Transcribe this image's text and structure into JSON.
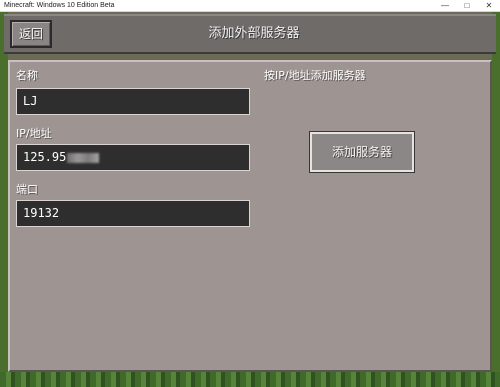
{
  "window": {
    "title": "Minecraft: Windows 10 Edition Beta",
    "min_icon": "—",
    "max_icon": "□",
    "close_icon": "✕"
  },
  "header": {
    "back_label": "返回",
    "title": "添加外部服务器"
  },
  "form": {
    "name_label": "名称",
    "name_value": "LJ",
    "ip_label": "IP/地址",
    "ip_value": "125.95",
    "port_label": "端口",
    "port_value": "19132"
  },
  "right": {
    "title": "按IP/地址添加服务器",
    "add_button": "添加服务器"
  }
}
